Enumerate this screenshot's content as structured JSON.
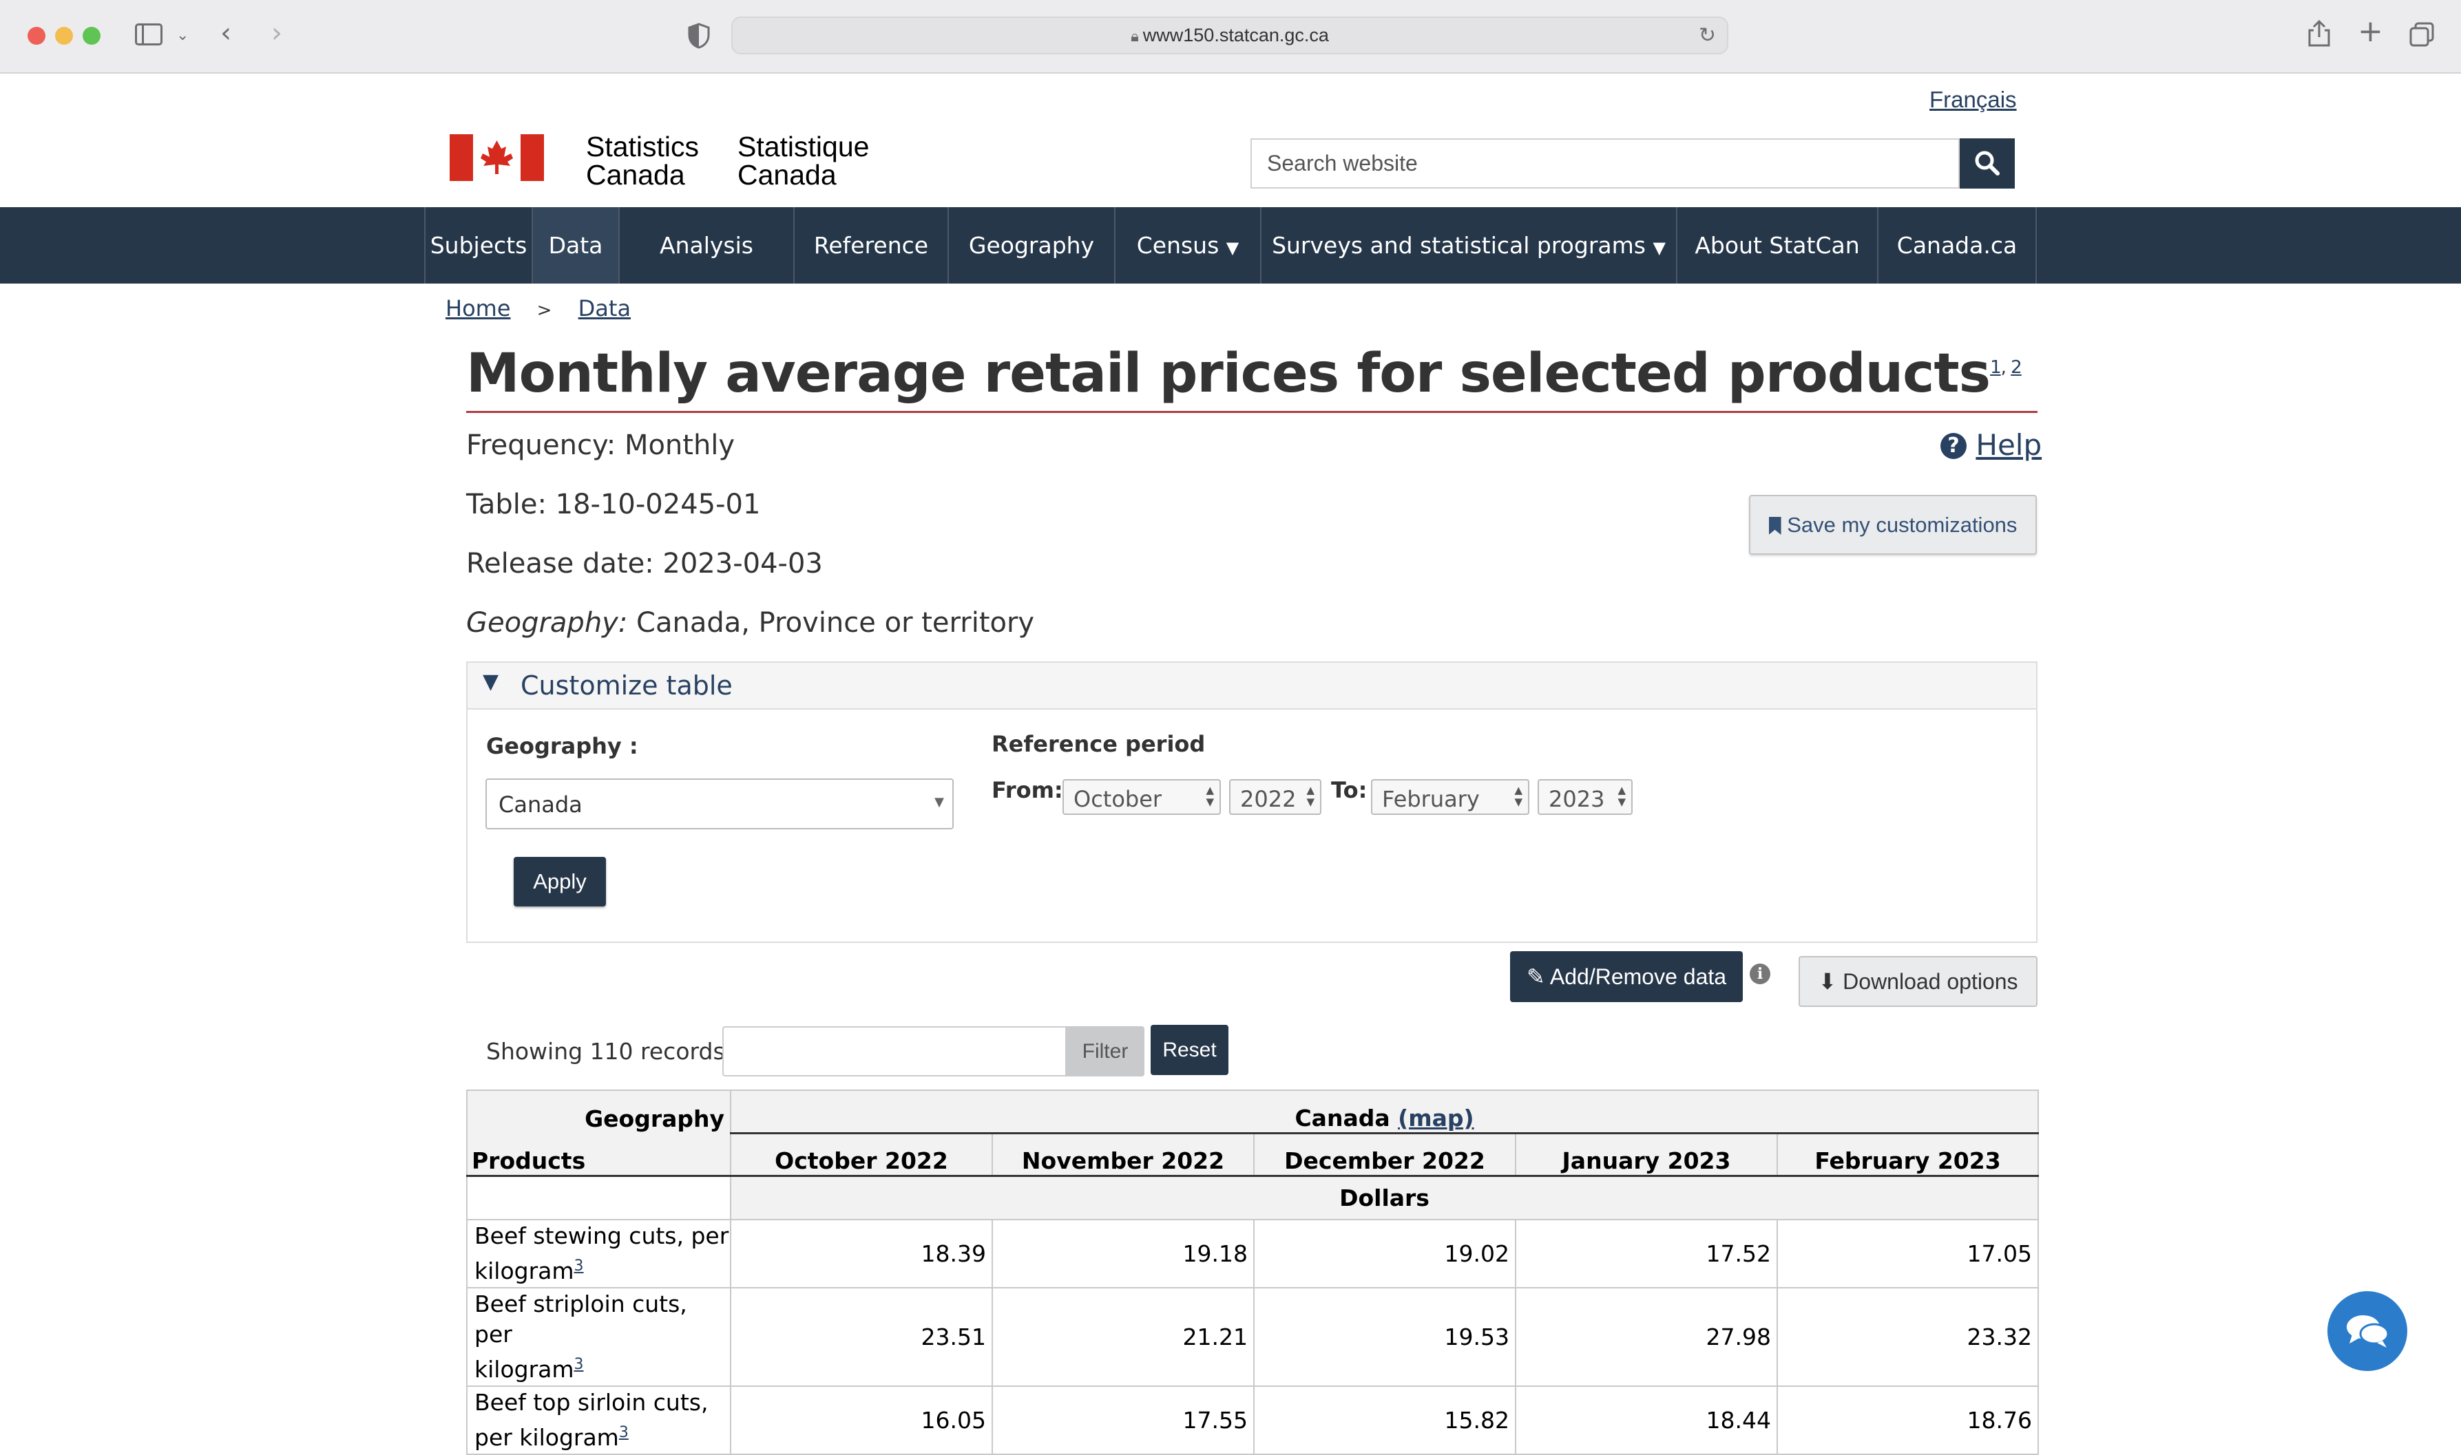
{
  "browser": {
    "url": "www150.statcan.gc.ca"
  },
  "header": {
    "language_link": "Français",
    "wordmark_en_line1": "Statistics",
    "wordmark_en_line2": "Canada",
    "wordmark_fr_line1": "Statistique",
    "wordmark_fr_line2": "Canada",
    "search_placeholder": "Search website",
    "flag_color": "#d52b1e"
  },
  "nav": {
    "items": [
      {
        "label": "Subjects"
      },
      {
        "label": "Data"
      },
      {
        "label": "Analysis"
      },
      {
        "label": "Reference"
      },
      {
        "label": "Geography"
      },
      {
        "label": "Census"
      },
      {
        "label": "Surveys and statistical programs"
      },
      {
        "label": "About StatCan"
      },
      {
        "label": "Canada.ca"
      }
    ],
    "active": "Data",
    "background": "#26374a"
  },
  "breadcrumb": {
    "home": "Home",
    "separator": ">",
    "data": "Data"
  },
  "page": {
    "title": "Monthly average retail prices for selected products",
    "title_footnote_1": "1",
    "title_footnote_2": "2",
    "frequency_label": "Frequency:",
    "frequency_value": "Monthly",
    "table_label": "Table:",
    "table_value": "18-10-0245-01",
    "release_label": "Release date:",
    "release_value": "2023-04-03",
    "geography_label": "Geography:",
    "geography_value": "Canada, Province or territory",
    "help_label": "Help",
    "save_label": "Save my customizations"
  },
  "customize": {
    "heading": "Customize table",
    "geography_label": "Geography :",
    "geography_selected": "Canada",
    "reference_period_label": "Reference period",
    "from_label": "From:",
    "from_month": "October",
    "from_year": "2022",
    "to_label": "To:",
    "to_month": "February",
    "to_year": "2023",
    "apply_label": "Apply"
  },
  "toolbar": {
    "add_remove_label": "Add/Remove data",
    "download_label": "Download options",
    "showing_records": "Showing 110 records",
    "filter_label": "Filter",
    "reset_label": "Reset"
  },
  "table": {
    "geography_header": "Geography",
    "geography_value": "Canada",
    "map_link": "(map)",
    "products_header": "Products",
    "months": [
      "October 2022",
      "November 2022",
      "December 2022",
      "January 2023",
      "February 2023"
    ],
    "unit": "Dollars",
    "rows": [
      {
        "line1": "Beef stewing cuts, per",
        "line2": "kilogram",
        "footnote": "3",
        "values": [
          "18.39",
          "19.18",
          "19.02",
          "17.52",
          "17.05"
        ]
      },
      {
        "line1": "Beef striploin cuts, per",
        "line2": "kilogram",
        "footnote": "3",
        "values": [
          "23.51",
          "21.21",
          "19.53",
          "27.98",
          "23.32"
        ]
      },
      {
        "line1": "Beef top sirloin cuts,",
        "line2": "per kilogram",
        "footnote": "3",
        "values": [
          "16.05",
          "17.55",
          "15.82",
          "18.44",
          "18.76"
        ]
      }
    ]
  }
}
